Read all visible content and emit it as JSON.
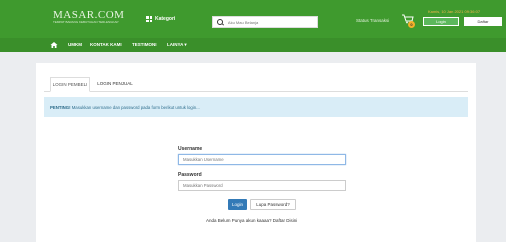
{
  "header": {
    "logo_title": "MASAR.COM",
    "logo_subtitle": "TEMPAT BARANG KEBUTUHAN TERLENGKAP",
    "kategori_label": "Kategori",
    "search_placeholder": "Aku Mau Belanja",
    "status_transaksi": "Status Transaksi",
    "date_text": "Kamis, 10 Jan 2021 09:36:07",
    "cart_count": "0",
    "login_label": "Login",
    "daftar_label": "Daftar"
  },
  "nav": {
    "items": [
      "UMKM",
      "KONTAK KAMI",
      "TESTIMONI",
      "LAINYA ▾"
    ]
  },
  "tabs": {
    "pembeli": "LOGIN PEMBELI",
    "penjual": "LOGIN PENJUAL"
  },
  "alert": {
    "strong": "PENTING!",
    "text": " Masukkan username dan password pada form berikut untuk login..."
  },
  "form": {
    "username_label": "Username",
    "username_placeholder": "Masukkan Username",
    "password_label": "Password",
    "password_placeholder": "Masukkan Password",
    "login_button": "Login",
    "lupa_button": "Lupa Password?",
    "footer_text": "Anda Belum Punya akun kaaaa? Daftar Disini"
  },
  "colors": {
    "header_green": "#3f9a2e",
    "nav_green": "#3a8f2a",
    "alert_bg": "#d9edf7",
    "primary_blue": "#337ab7"
  }
}
